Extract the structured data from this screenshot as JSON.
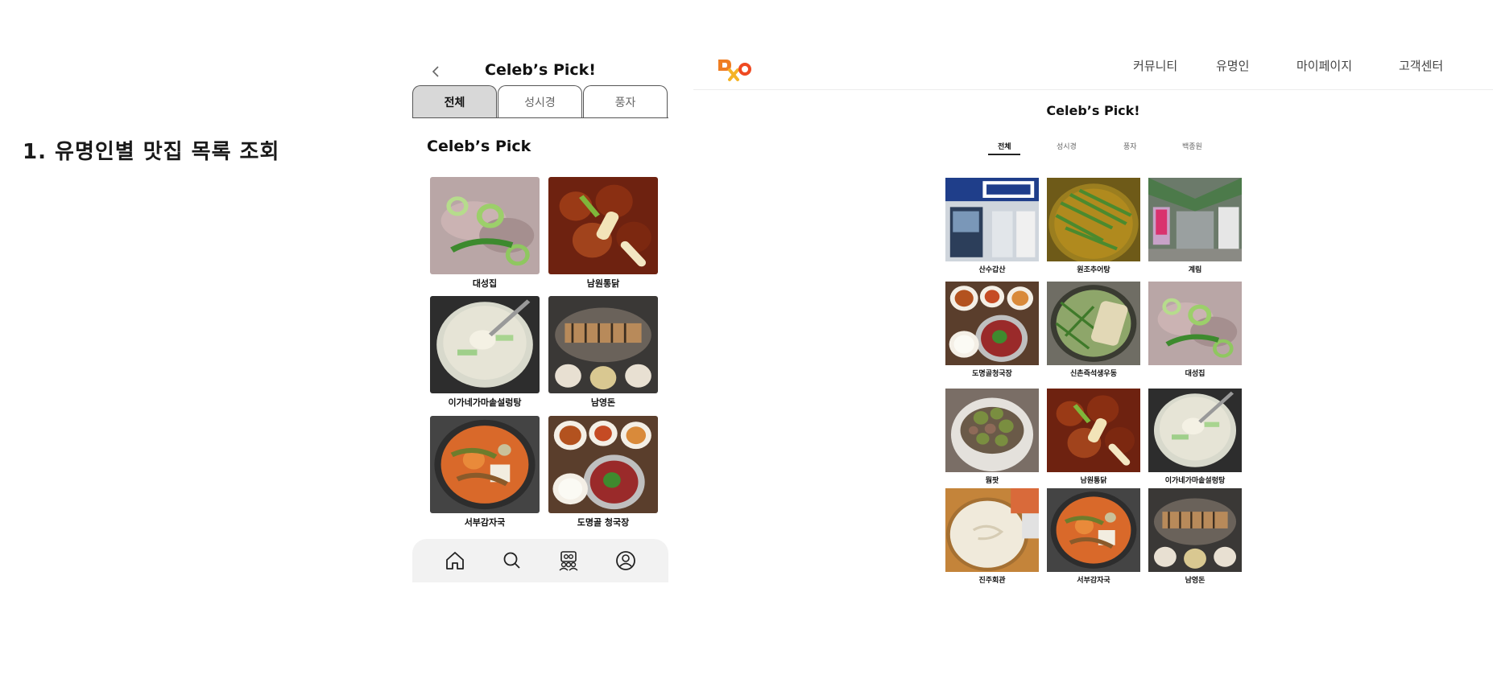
{
  "section": {
    "title": "1. 유명인별 맛집 목록 조회"
  },
  "mobile": {
    "title": "Celeb’s Pick!",
    "tabs": [
      {
        "label": "전체",
        "active": true
      },
      {
        "label": "성시경",
        "active": false
      },
      {
        "label": "풍자",
        "active": false
      }
    ],
    "subtitle": "Celeb’s Pick",
    "restaurants": [
      {
        "name": "대성집",
        "photo": "soup"
      },
      {
        "name": "남원통닭",
        "photo": "fried"
      },
      {
        "name": "이가네가마솥설렁탕",
        "photo": "milky"
      },
      {
        "name": "남영돈",
        "photo": "grill"
      },
      {
        "name": "서부감자국",
        "photo": "stew"
      },
      {
        "name": "도명골 청국장",
        "photo": "sides"
      }
    ],
    "nav": [
      "home-icon",
      "search-icon",
      "community-icon",
      "profile-icon"
    ]
  },
  "desktop": {
    "menu": [
      "커뮤니티",
      "유명인",
      "마이페이지",
      "고객센터"
    ],
    "title": "Celeb’s Pick!",
    "tabs": [
      {
        "label": "전체",
        "active": true
      },
      {
        "label": "성시경",
        "active": false
      },
      {
        "label": "풍자",
        "active": false
      },
      {
        "label": "백종원",
        "active": false
      }
    ],
    "restaurants": [
      {
        "name": "산수갑산",
        "photo": "store"
      },
      {
        "name": "원조추어탕",
        "photo": "greenstew"
      },
      {
        "name": "계림",
        "photo": "market"
      },
      {
        "name": "도명골청국장",
        "photo": "sides"
      },
      {
        "name": "신촌즉석생우동",
        "photo": "noodle"
      },
      {
        "name": "대성집",
        "photo": "soup"
      },
      {
        "name": "뭠팟",
        "photo": "meatgreen"
      },
      {
        "name": "남원통닭",
        "photo": "fried"
      },
      {
        "name": "이가네가마솥설렁탕",
        "photo": "milky"
      },
      {
        "name": "진주회관",
        "photo": "whitesoup"
      },
      {
        "name": "서부감자국",
        "photo": "stew"
      },
      {
        "name": "남영돈",
        "photo": "grill"
      }
    ]
  },
  "colors": {
    "logo_orange": "#ef7d22",
    "logo_yellow": "#f5b324",
    "tab_active_bg": "#d8d8d8"
  }
}
